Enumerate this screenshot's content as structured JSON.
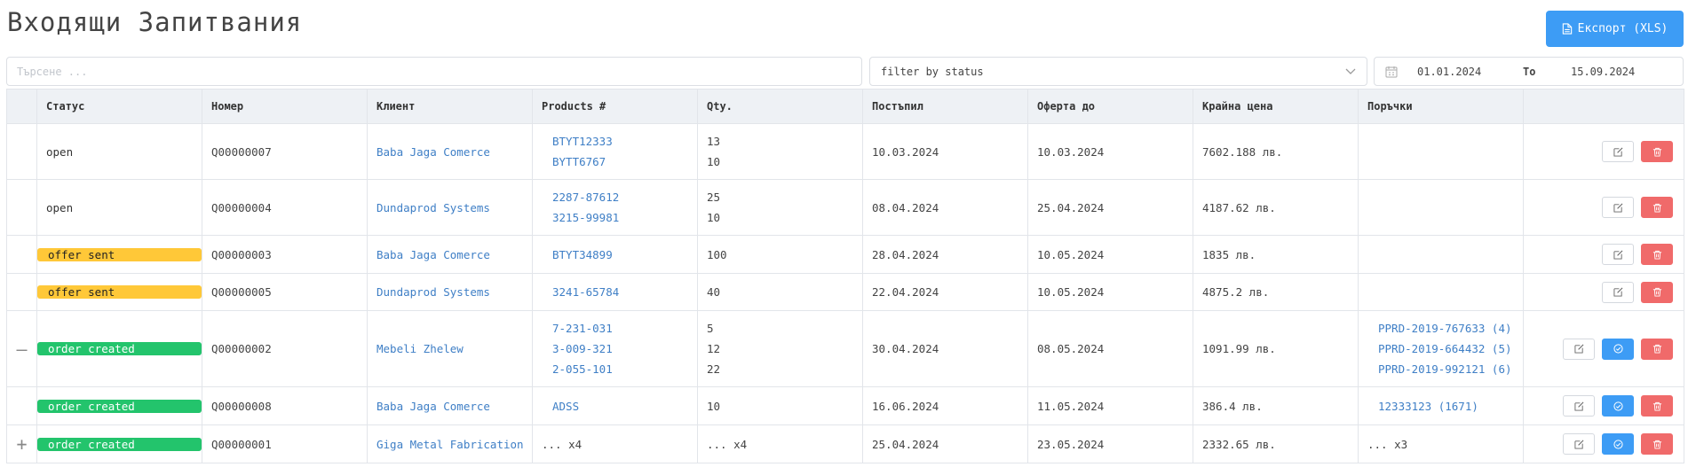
{
  "page": {
    "title": "Входящи Запитвания"
  },
  "toolbar": {
    "export_label": "Експорт (XLS)"
  },
  "filters": {
    "search_placeholder": "Търсене ...",
    "status_placeholder": "filter by status",
    "date_from": "01.01.2024",
    "date_to_label": "To",
    "date_to": "15.09.2024"
  },
  "table": {
    "headers": {
      "status": "Статус",
      "number": "Номер",
      "client": "Клиент",
      "products": "Products #",
      "qty": "Qty.",
      "received": "Постъпил",
      "offer_until": "Оферта до",
      "final_price": "Крайна цена",
      "orders": "Поръчки"
    },
    "rows": [
      {
        "status": "open",
        "number": "Q00000007",
        "client": "Baba Jaga Comerce",
        "products": [
          "BTYT12333",
          "BYTT6767"
        ],
        "qty": [
          "13",
          "10"
        ],
        "received": "10.03.2024",
        "offer_until": "10.03.2024",
        "final_price": "7602.188 лв.",
        "orders": []
      },
      {
        "status": "open",
        "number": "Q00000004",
        "client": "Dundaprod Systems",
        "products": [
          "2287-87612",
          "3215-99981"
        ],
        "qty": [
          "25",
          "10"
        ],
        "received": "08.04.2024",
        "offer_until": "25.04.2024",
        "final_price": "4187.62 лв.",
        "orders": []
      },
      {
        "status": "offer sent",
        "number": "Q00000003",
        "client": "Baba Jaga Comerce",
        "products": [
          "BTYT34899"
        ],
        "qty": [
          "100"
        ],
        "received": "28.04.2024",
        "offer_until": "10.05.2024",
        "final_price": "1835 лв.",
        "orders": []
      },
      {
        "status": "offer sent",
        "number": "Q00000005",
        "client": "Dundaprod Systems",
        "products": [
          "3241-65784"
        ],
        "qty": [
          "40"
        ],
        "received": "22.04.2024",
        "offer_until": "10.05.2024",
        "final_price": "4875.2 лв.",
        "orders": []
      },
      {
        "status": "order created",
        "expander": "—",
        "number": "Q00000002",
        "client": "Mebeli Zhelew",
        "products": [
          "7-231-031",
          "3-009-321",
          "2-055-101"
        ],
        "qty": [
          "5",
          "12",
          "22"
        ],
        "received": "30.04.2024",
        "offer_until": "08.05.2024",
        "final_price": "1091.99 лв.",
        "orders": [
          "PPRD-2019-767633 (4)",
          "PPRD-2019-664432 (5)",
          "PPRD-2019-992121 (6)"
        ]
      },
      {
        "status": "order created",
        "number": "Q00000008",
        "client": "Baba Jaga Comerce",
        "products": [
          "ADSS"
        ],
        "qty": [
          "10"
        ],
        "received": "16.06.2024",
        "offer_until": "11.05.2024",
        "final_price": "386.4 лв.",
        "orders": [
          "12333123 (1671)"
        ]
      },
      {
        "status": "order created",
        "expander": "+",
        "number": "Q00000001",
        "client": "Giga Metal Fabrication",
        "products_summary": "... x4",
        "qty_summary": "... x4",
        "received": "25.04.2024",
        "offer_until": "23.05.2024",
        "final_price": "2332.65 лв.",
        "orders_summary": "... x3"
      }
    ]
  },
  "colors": {
    "accent": "#3d9cf5",
    "offer_sent": "#ffc838",
    "order_created": "#23c46c",
    "delete": "#f06a6a",
    "link": "#3f7fc6"
  },
  "icons": {
    "export": "file-icon",
    "dropdown": "chevron-down-icon",
    "date": "calendar-icon",
    "edit": "edit-icon",
    "approve": "check-circle-icon",
    "delete": "trash-icon"
  }
}
